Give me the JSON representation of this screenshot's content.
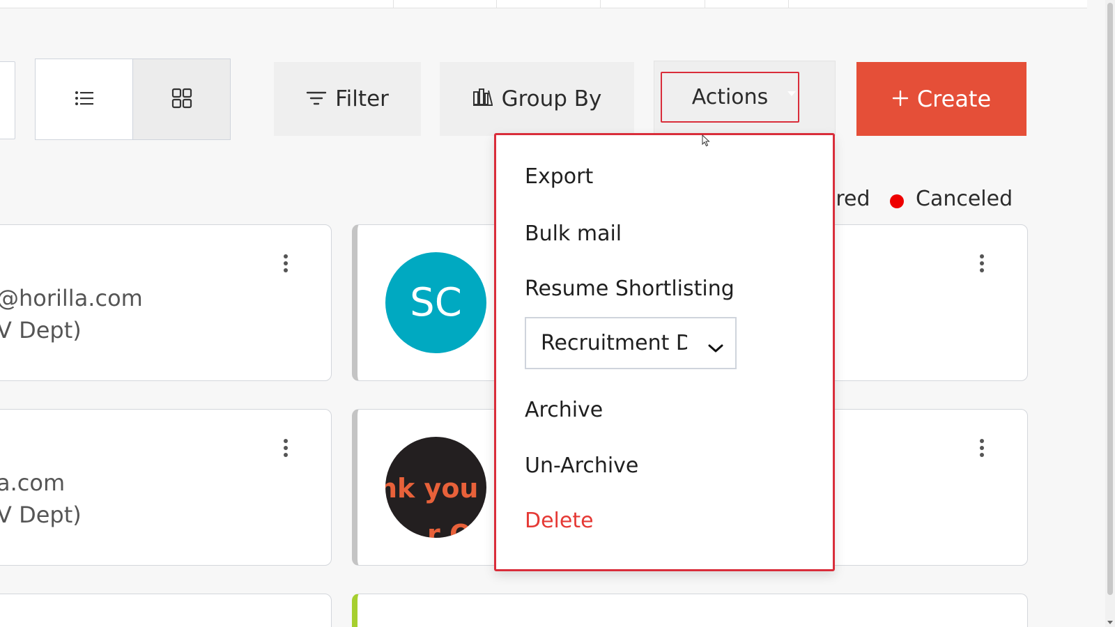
{
  "toolbar": {
    "filter_label": "Filter",
    "group_by_label": "Group By",
    "actions_label": "Actions",
    "create_label": "Create",
    "list_view_icon": "list-icon",
    "grid_view_icon": "grid-icon",
    "filter_icon": "filter-icon",
    "group_by_icon": "group-by-icon",
    "create_icon": "plus-icon"
  },
  "legend": {
    "items": [
      {
        "label": "ired"
      },
      {
        "label": "Canceled",
        "color": "#ee0000"
      }
    ]
  },
  "actions_menu": {
    "items": [
      {
        "label": "Export"
      },
      {
        "label": "Bulk mail"
      },
      {
        "label": "Resume Shortlisting"
      },
      {
        "label": "Archive"
      },
      {
        "label": "Un-Archive"
      },
      {
        "label": "Delete",
        "color": "#e53935"
      }
    ],
    "resume_select": {
      "value": "Recruitment D"
    }
  },
  "cards": [
    {
      "lines": [
        "@horilla.com",
        "V Dept)"
      ]
    },
    {
      "avatar_initials": "SC"
    },
    {
      "lines": [
        "a.com",
        "V Dept)"
      ]
    },
    {
      "avatar_image_text": [
        "nk you f",
        "r O"
      ]
    }
  ],
  "colors": {
    "accent": "#e54f38",
    "highlight": "#d92d3a",
    "avatar_sc": "#00a9c1"
  }
}
